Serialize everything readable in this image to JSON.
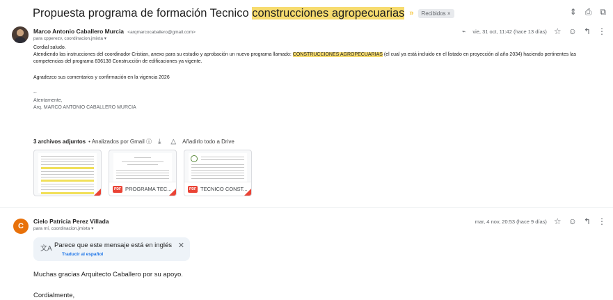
{
  "thread": {
    "subject_prefix": "Propuesta programa de formación Tecnico ",
    "subject_highlight": "construcciones agropecuarias",
    "label": "Recibidos ×",
    "important_icon": "important-marker-icon"
  },
  "message1": {
    "sender_name": "Marco Antonio Caballero Murcia",
    "sender_email": "<arqmarcocaballero@gmail.com>",
    "to": "para cpperezv, coordinacion.jmixta ▾",
    "date": "vie, 31 oct, 11:42 (hace 13 días)",
    "greeting": "Cordial saludo.",
    "body_a": "Atendiendo las instrucciones del coordinador Cristian, anexo para su estudio y aprobación un nuevo programa llamado: ",
    "body_highlight": "CONSTRUCCIONES AGROPECUARIAS",
    "body_b": " (el cual ya está incluido en el listado en proyección al año 2034) haciendo pertinentes las",
    "body_line2": "competencias del programa 836138 Construcción de edificaciones ya vigente.",
    "thanks": "Agradezco sus comentarios y confirmación en la vigencia 2026",
    "dashes": "--",
    "closing": "Atentamente,",
    "signature": "Arq. MARCO ANTONIO CABALLERO MURCIA"
  },
  "attachments": {
    "count_label": "3 archivos adjuntos",
    "scanned": " • Analizados por Gmail ⓘ",
    "add_drive": "Añadirlo todo a Drive",
    "items": [
      {
        "name": ""
      },
      {
        "name": "PROGRAMA TEC..."
      },
      {
        "name": "TECNICO CONST..."
      }
    ],
    "pdf_badge": "PDF"
  },
  "message2": {
    "avatar_letter": "C",
    "sender_name": "Cielo Patricia Perez Villada",
    "to": "para mí, coordinacion.jmixta ▾",
    "date": "mar, 4 nov, 20:53 (hace 9 días)",
    "translate_notice": "Parece que este mensaje está en inglés",
    "translate_link": "Traducir al español",
    "line1": "Muchas gracias Arquitecto Caballero por su apoyo.",
    "line2": "Cordialmente,"
  },
  "colors": {
    "highlight": "#f7dc6f",
    "avatar_orange": "#e8710a",
    "link": "#1a73e8"
  }
}
